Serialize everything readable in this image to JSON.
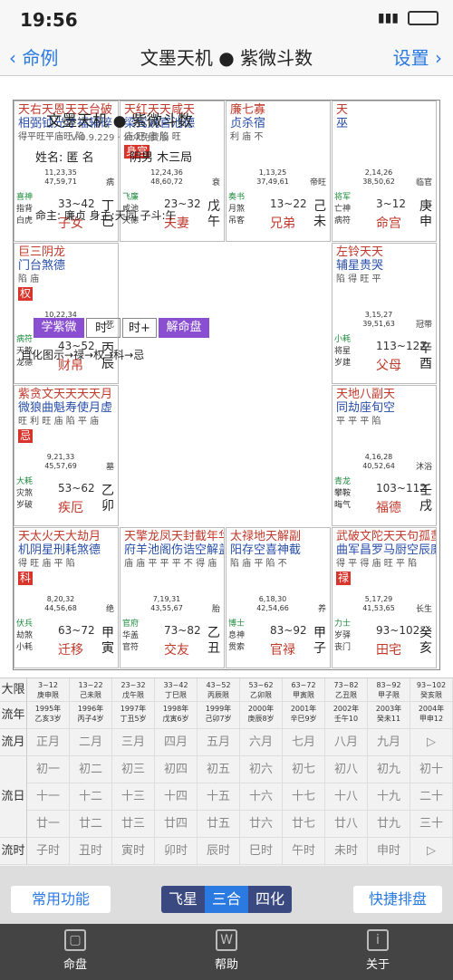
{
  "status": {
    "time": "19:56"
  },
  "nav": {
    "back": "命例",
    "title": "文墨天机 ● 紫微斗数",
    "settings": "设置"
  },
  "cells": [
    {
      "r1": "天右天恩天天台破",
      "r2": "相弼钺光才福辅碎",
      "r3": "得平旺平庙旺  陷",
      "tag": "",
      "nums": "11,23,35\n47,59,71",
      "side": "病",
      "b1": "喜神",
      "b2": "指背",
      "b3": "白虎",
      "range": "33~42",
      "palace": "子女",
      "gz": "丁巳"
    },
    {
      "r1": "天红天天咸天",
      "r2": "梁鸾姚官池德",
      "r3": "庙 旺 庙 陷 旺",
      "tag": "身宫",
      "nums": "12,24,36\n48,60,72",
      "side": "衰",
      "b1": "飞廉",
      "b2": "咸池",
      "b3": "天德",
      "range": "23~32",
      "palace": "夫妻",
      "gz": "戊午"
    },
    {
      "r1": "廉七寡",
      "r2": "贞杀宿",
      "r3": "利 庙 不",
      "tag": "",
      "nums": "1,13,25\n37,49,61",
      "side": "帝旺",
      "b1": "奏书",
      "b2": "月煞",
      "b3": "吊客",
      "range": "13~22",
      "palace": "兄弟",
      "gz": "己未"
    },
    {
      "r1": "天",
      "r2": "巫",
      "r3": "",
      "tag": "",
      "nums": "2,14,26\n38,50,62",
      "side": "临官",
      "b1": "将军",
      "b2": "亡神",
      "b3": "病符",
      "range": "3~12",
      "palace": "命宫",
      "gz": "庚申"
    },
    {
      "r1": "巨三阴龙",
      "r2": "门台煞德",
      "r3": "陷 庙",
      "tag": "权",
      "nums": "10,22,34\n46,58,70",
      "side": "死",
      "b1": "病符",
      "b2": "天煞",
      "b3": "龙德",
      "range": "43~52",
      "palace": "财帛",
      "gz": "丙辰"
    },
    {
      "r1": "左铃天天",
      "r2": "辅星贵哭",
      "r3": "陷 得 旺 平",
      "tag": "",
      "nums": "3,15,27\n39,51,63",
      "side": "冠带",
      "b1": "小耗",
      "b2": "将星",
      "b3": "岁建",
      "range": "113~122",
      "palace": "父母",
      "gz": "辛酉"
    },
    {
      "r1": "紫贪文天天天天月",
      "r2": "微狼曲魁寿使月虚",
      "r3": "旺 利 旺 庙 陷 平 庙",
      "tag": "忌",
      "nums": "9,21,33\n45,57,69",
      "side": "墓",
      "b1": "大耗",
      "b2": "灾煞",
      "b3": "岁破",
      "range": "53~62",
      "palace": "疾厄",
      "gz": "乙卯"
    },
    {
      "r1": "天地八副天",
      "r2": "同劫座旬空",
      "r3": "平 平 平 陷",
      "tag": "",
      "nums": "4,16,28\n40,52,64",
      "side": "沐浴",
      "b1": "青龙",
      "b2": "攀鞍",
      "b3": "晦气",
      "range": "103~112",
      "palace": "福德",
      "gz": "壬戌"
    },
    {
      "r1": "天太火天大劫月",
      "r2": "机阴星刑耗煞德",
      "r3": "得 旺 庙 平 陷",
      "tag": "科",
      "nums": "8,20,32\n44,56,68",
      "side": "绝",
      "b1": "伏兵",
      "b2": "劫煞",
      "b3": "小耗",
      "range": "63~72",
      "palace": "迁移",
      "gz": "甲寅"
    },
    {
      "r1": "天擎龙凤天封截年华",
      "r2": "府羊池阁伤诰空解盖",
      "r3": "庙 庙 平 平 平 不 得 庙",
      "tag": "",
      "nums": "7,19,31\n43,55,67",
      "side": "胎",
      "b1": "官府",
      "b2": "华盖",
      "b3": "官符",
      "range": "73~82",
      "palace": "交友",
      "gz": "乙丑"
    },
    {
      "r1": "太禄地天解副",
      "r2": "阳存空喜神截",
      "r3": "陷 庙 平 陷 不",
      "tag": "",
      "nums": "6,18,30\n42,54,66",
      "side": "养",
      "b1": "博士",
      "b2": "息神",
      "b3": "贯索",
      "range": "83~92",
      "palace": "官禄",
      "gz": "甲子"
    },
    {
      "r1": "武破文陀天天句孤蜚",
      "r2": "曲军昌罗马厨空辰廉",
      "r3": "得 平 得 庙 旺 平 陷",
      "tag": "禄",
      "nums": "5,17,29\n41,53,65",
      "side": "长生",
      "b1": "力士",
      "b2": "岁驿",
      "b3": "丧门",
      "range": "93~102",
      "palace": "田宅",
      "gz": "癸亥"
    }
  ],
  "center": {
    "title": "文墨天机 ● 紫微斗数",
    "version": "V 0.9.229 · 公众免费版",
    "name": "姓名: 匿 名",
    "gender": "阴男 木三局",
    "ming": "命主: 廉贞 身主:天同  子斗:午",
    "btn1": "学紫微",
    "btn2": "时-",
    "btn3": "时+",
    "btn4": "解命盘",
    "legend": "自化图示→禄→权→科→忌"
  },
  "grid": {
    "heads": [
      "大限",
      "流年",
      "流月",
      "流日",
      "",
      "",
      "流时"
    ],
    "daxian": [
      "3~12\n庚申限",
      "13~22\n己未限",
      "23~32\n戊午限",
      "33~42\n丁巳限",
      "43~52\n丙辰限",
      "53~62\n乙卯限",
      "63~72\n甲寅限",
      "73~82\n乙丑限",
      "83~92\n甲子限",
      "93~102\n癸亥限"
    ],
    "liunian": [
      "1995年\n乙亥3岁",
      "1996年\n丙子4岁",
      "1997年\n丁丑5岁",
      "1998年\n戊寅6岁",
      "1999年\n己卯7岁",
      "2000年\n庚辰8岁",
      "2001年\n辛巳9岁",
      "2002年\n壬午10",
      "2003年\n癸未11",
      "2004年\n甲申12"
    ],
    "liuyue": [
      "正月",
      "二月",
      "三月",
      "四月",
      "五月",
      "六月",
      "七月",
      "八月",
      "九月",
      "▷"
    ],
    "r1": [
      "初一",
      "初二",
      "初三",
      "初四",
      "初五",
      "初六",
      "初七",
      "初八",
      "初九",
      "初十"
    ],
    "r2": [
      "十一",
      "十二",
      "十三",
      "十四",
      "十五",
      "十六",
      "十七",
      "十八",
      "十九",
      "二十"
    ],
    "r3": [
      "廿一",
      "廿二",
      "廿三",
      "廿四",
      "廿五",
      "廿六",
      "廿七",
      "廿八",
      "廿九",
      "三十"
    ],
    "liushi": [
      "子时",
      "丑时",
      "寅时",
      "卯时",
      "辰时",
      "巳时",
      "午时",
      "未时",
      "申时",
      "▷"
    ]
  },
  "toolbar": {
    "common": "常用功能",
    "seg": [
      "飞星",
      "三合",
      "四化"
    ],
    "quick": "快捷排盘"
  },
  "tabs": [
    {
      "label": "命盘",
      "icon": "chart-icon"
    },
    {
      "label": "帮助",
      "icon": "help-icon"
    },
    {
      "label": "关于",
      "icon": "info-icon"
    }
  ]
}
